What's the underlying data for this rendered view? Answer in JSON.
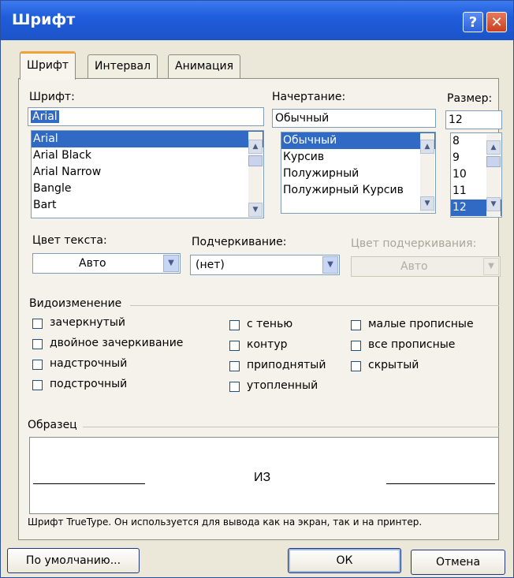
{
  "window": {
    "title": "Шрифт",
    "help_glyph": "?",
    "close_glyph": "✕"
  },
  "tabs": [
    {
      "label": "Шрифт",
      "active": true
    },
    {
      "label": "Интервал",
      "active": false
    },
    {
      "label": "Анимация",
      "active": false
    }
  ],
  "font": {
    "label": "Шрифт:",
    "value": "Arial",
    "items": [
      "Arial",
      "Arial Black",
      "Arial Narrow",
      "Bangle",
      "Bart"
    ],
    "selected_index": 0
  },
  "style": {
    "label": "Начертание:",
    "value": "Обычный",
    "items": [
      "Обычный",
      "Курсив",
      "Полужирный",
      "Полужирный Курсив"
    ],
    "selected_index": 0
  },
  "size": {
    "label": "Размер:",
    "value": "12",
    "items": [
      "8",
      "9",
      "10",
      "11",
      "12"
    ],
    "selected_index": 4
  },
  "text_color": {
    "label": "Цвет текста:",
    "value": "Авто"
  },
  "underline": {
    "label": "Подчеркивание:",
    "value": "(нет)"
  },
  "underline_color": {
    "label": "Цвет подчеркивания:",
    "value": "Авто",
    "enabled": false
  },
  "effects": {
    "label": "Видоизменение",
    "items": [
      {
        "label": "зачеркнутый",
        "checked": false
      },
      {
        "label": "двойное зачеркивание",
        "checked": false
      },
      {
        "label": "надстрочный",
        "checked": false
      },
      {
        "label": "подстрочный",
        "checked": false
      },
      {
        "label": "с тенью",
        "checked": false
      },
      {
        "label": "контур",
        "checked": false
      },
      {
        "label": "приподнятый",
        "checked": false
      },
      {
        "label": "утопленный",
        "checked": false
      },
      {
        "label": "малые прописные",
        "checked": false
      },
      {
        "label": "все прописные",
        "checked": false
      },
      {
        "label": "скрытый",
        "checked": false
      }
    ]
  },
  "preview": {
    "label": "Образец",
    "sample_text": "ИЗ",
    "note": "Шрифт TrueType. Он используется для вывода как на экран, так и на принтер."
  },
  "buttons": {
    "default": "По умолчанию...",
    "ok": "ОК",
    "cancel": "Отмена"
  }
}
